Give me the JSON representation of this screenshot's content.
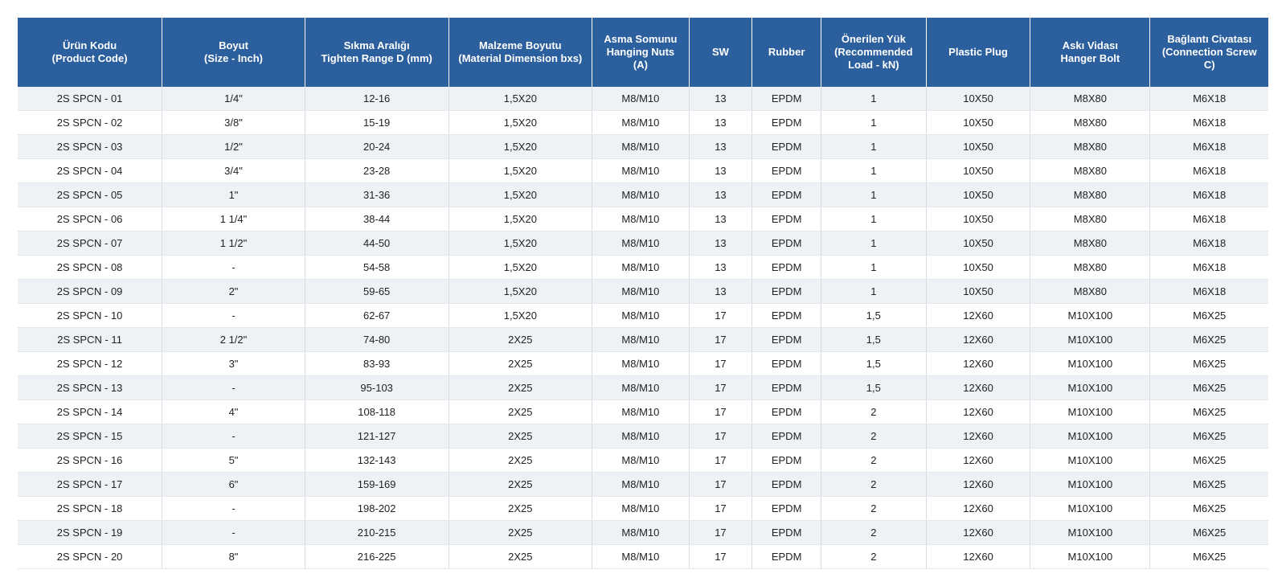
{
  "table": {
    "headers": [
      "Ürün Kodu\n(Product Code)",
      "Boyut\n(Size - Inch)",
      "Sıkma Aralığı\nTighten Range D (mm)",
      "Malzeme Boyutu\n(Material Dimension bxs)",
      "Asma Somunu\nHanging Nuts\n(A)",
      "SW",
      "Rubber",
      "Önerilen Yük\n(Recommended\nLoad - kN)",
      "Plastic Plug",
      "Askı  Vidası\nHanger Bolt",
      "Bağlantı Civatası\n(Connection Screw\nC)"
    ],
    "rows": [
      [
        "2S SPCN - 01",
        "1/4\"",
        "12-16",
        "1,5X20",
        "M8/M10",
        "13",
        "EPDM",
        "1",
        "10X50",
        "M8X80",
        "M6X18"
      ],
      [
        "2S SPCN - 02",
        "3/8\"",
        "15-19",
        "1,5X20",
        "M8/M10",
        "13",
        "EPDM",
        "1",
        "10X50",
        "M8X80",
        "M6X18"
      ],
      [
        "2S SPCN - 03",
        "1/2\"",
        "20-24",
        "1,5X20",
        "M8/M10",
        "13",
        "EPDM",
        "1",
        "10X50",
        "M8X80",
        "M6X18"
      ],
      [
        "2S SPCN - 04",
        "3/4\"",
        "23-28",
        "1,5X20",
        "M8/M10",
        "13",
        "EPDM",
        "1",
        "10X50",
        "M8X80",
        "M6X18"
      ],
      [
        "2S SPCN - 05",
        "1\"",
        "31-36",
        "1,5X20",
        "M8/M10",
        "13",
        "EPDM",
        "1",
        "10X50",
        "M8X80",
        "M6X18"
      ],
      [
        "2S SPCN - 06",
        "1 1/4\"",
        "38-44",
        "1,5X20",
        "M8/M10",
        "13",
        "EPDM",
        "1",
        "10X50",
        "M8X80",
        "M6X18"
      ],
      [
        "2S SPCN - 07",
        "1 1/2\"",
        "44-50",
        "1,5X20",
        "M8/M10",
        "13",
        "EPDM",
        "1",
        "10X50",
        "M8X80",
        "M6X18"
      ],
      [
        "2S SPCN - 08",
        "-",
        "54-58",
        "1,5X20",
        "M8/M10",
        "13",
        "EPDM",
        "1",
        "10X50",
        "M8X80",
        "M6X18"
      ],
      [
        "2S SPCN - 09",
        "2\"",
        "59-65",
        "1,5X20",
        "M8/M10",
        "13",
        "EPDM",
        "1",
        "10X50",
        "M8X80",
        "M6X18"
      ],
      [
        "2S SPCN - 10",
        "-",
        "62-67",
        "1,5X20",
        "M8/M10",
        "17",
        "EPDM",
        "1,5",
        "12X60",
        "M10X100",
        "M6X25"
      ],
      [
        "2S SPCN - 11",
        "2 1/2\"",
        "74-80",
        "2X25",
        "M8/M10",
        "17",
        "EPDM",
        "1,5",
        "12X60",
        "M10X100",
        "M6X25"
      ],
      [
        "2S SPCN - 12",
        "3\"",
        "83-93",
        "2X25",
        "M8/M10",
        "17",
        "EPDM",
        "1,5",
        "12X60",
        "M10X100",
        "M6X25"
      ],
      [
        "2S SPCN - 13",
        "-",
        "95-103",
        "2X25",
        "M8/M10",
        "17",
        "EPDM",
        "1,5",
        "12X60",
        "M10X100",
        "M6X25"
      ],
      [
        "2S SPCN - 14",
        "4\"",
        "108-118",
        "2X25",
        "M8/M10",
        "17",
        "EPDM",
        "2",
        "12X60",
        "M10X100",
        "M6X25"
      ],
      [
        "2S SPCN - 15",
        "-",
        "121-127",
        "2X25",
        "M8/M10",
        "17",
        "EPDM",
        "2",
        "12X60",
        "M10X100",
        "M6X25"
      ],
      [
        "2S SPCN - 16",
        "5\"",
        "132-143",
        "2X25",
        "M8/M10",
        "17",
        "EPDM",
        "2",
        "12X60",
        "M10X100",
        "M6X25"
      ],
      [
        "2S SPCN - 17",
        "6\"",
        "159-169",
        "2X25",
        "M8/M10",
        "17",
        "EPDM",
        "2",
        "12X60",
        "M10X100",
        "M6X25"
      ],
      [
        "2S SPCN - 18",
        "-",
        "198-202",
        "2X25",
        "M8/M10",
        "17",
        "EPDM",
        "2",
        "12X60",
        "M10X100",
        "M6X25"
      ],
      [
        "2S SPCN - 19",
        "-",
        "210-215",
        "2X25",
        "M8/M10",
        "17",
        "EPDM",
        "2",
        "12X60",
        "M10X100",
        "M6X25"
      ],
      [
        "2S SPCN - 20",
        "8\"",
        "216-225",
        "2X25",
        "M8/M10",
        "17",
        "EPDM",
        "2",
        "12X60",
        "M10X100",
        "M6X25"
      ]
    ]
  },
  "colors": {
    "header_bg": "#2b5f9e",
    "header_text": "#ffffff",
    "row_alt_bg": "#eef1f5"
  }
}
